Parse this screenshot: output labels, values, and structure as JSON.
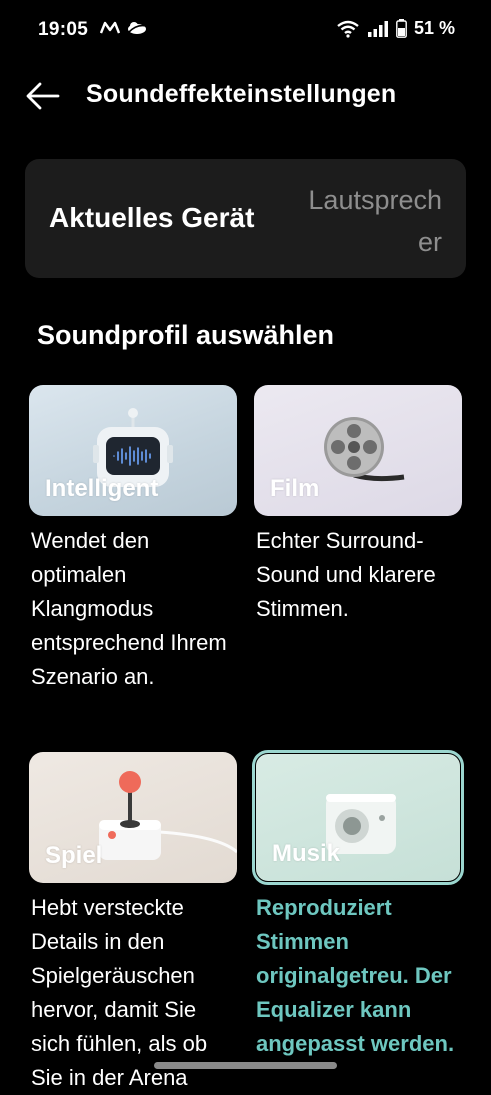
{
  "status_bar": {
    "time": "19:05",
    "battery": "51 %"
  },
  "header": {
    "title": "Soundeffekteinstellungen"
  },
  "device": {
    "label": "Aktuelles Gerät",
    "value": "Lautsprecher"
  },
  "section": {
    "title": "Soundprofil auswählen"
  },
  "profiles": [
    {
      "label": "Intelligent",
      "description": "Wendet den optimalen Klangmodus entsprechend Ihrem Szenario an.",
      "icon": "robot-waveform-icon",
      "selected": false
    },
    {
      "label": "Film",
      "description": "Echter Surround-Sound und klarere Stimmen.",
      "icon": "film-reel-icon",
      "selected": false
    },
    {
      "label": "Spiel",
      "description": "Hebt versteckte Details in den Spielgeräuschen hervor, damit Sie sich fühlen, als ob Sie in der Arena",
      "icon": "joystick-icon",
      "selected": false
    },
    {
      "label": "Musik",
      "description": "Reproduziert Stimmen originalgetreu. Der Equalizer kann angepasst werden.",
      "icon": "speaker-icon",
      "selected": true
    }
  ],
  "colors": {
    "accent": "#6ec7c0",
    "card_background": "#1c1c1c",
    "secondary_text": "#8e8e8e"
  }
}
